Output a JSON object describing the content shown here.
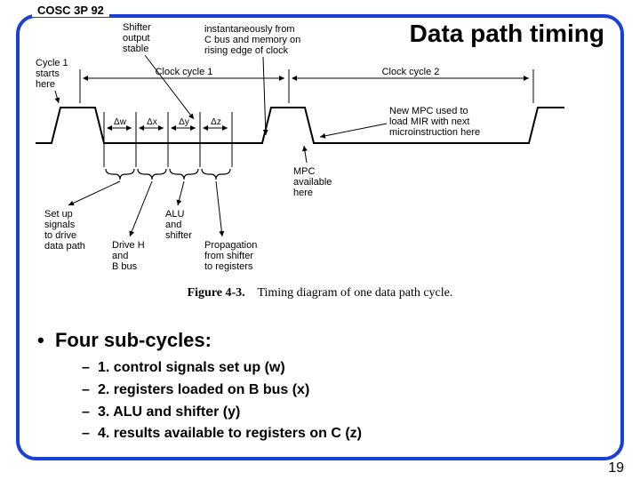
{
  "course_code": "COSC 3P 92",
  "title": "Data path timing",
  "diagram": {
    "top_labels": {
      "shifter_output": "Shifter\noutput\nstable",
      "registers_loaded": "Registers loaded\ninstantaneously from\nC bus and memory on\nrising edge of clock"
    },
    "cycle1_start": "Cycle 1\nstarts\nhere",
    "clock_cycle_1": "Clock cycle 1",
    "clock_cycle_2": "Clock cycle 2",
    "deltas": {
      "w": "Δw",
      "x": "Δx",
      "y": "Δy",
      "z": "Δz"
    },
    "right_label": "New MPC used to\nload MIR with next\nmicroinstruction here",
    "mpc_avail": "MPC\navailable\nhere",
    "bottom": {
      "setup": "Set up\nsignals\nto drive\ndata path",
      "drive": "Drive H\nand\nB bus",
      "alu": "ALU\nand\nshifter",
      "prop": "Propagation\nfrom shifter\nto registers"
    }
  },
  "caption_bold": "Figure 4-3.",
  "caption_rest": "Timing diagram of one data path cycle.",
  "bullet_main": "Four sub-cycles:",
  "subcycles": [
    "1. control signals set up (w)",
    "2. registers loaded on B bus (x)",
    "3. ALU and shifter (y)",
    "4. results available to registers on C (z)"
  ],
  "page_number": "19"
}
